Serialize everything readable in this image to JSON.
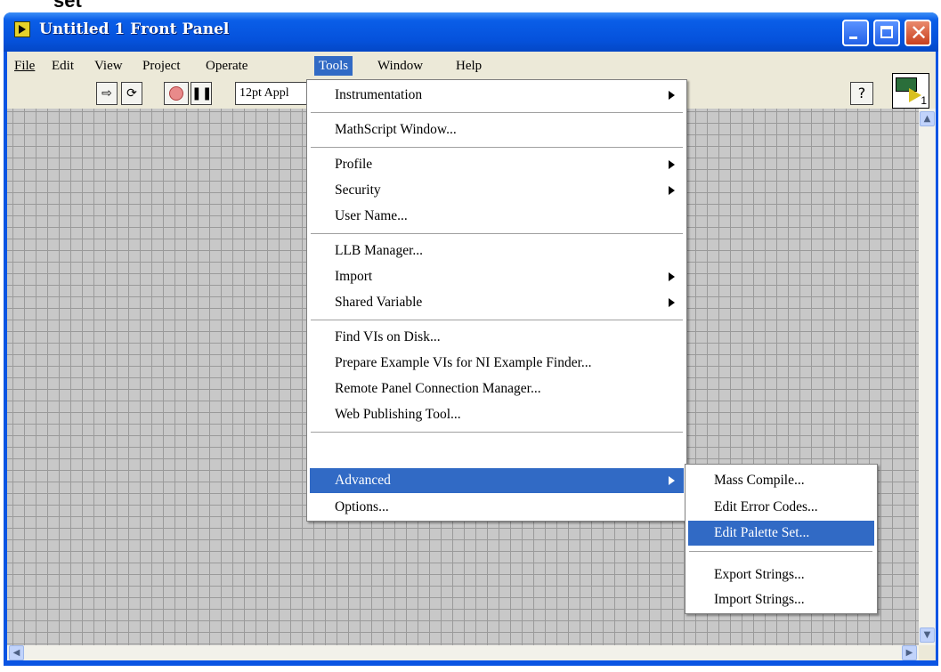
{
  "window": {
    "title": "Untitled 1 Front Panel"
  },
  "menubar": [
    "File",
    "Edit",
    "View",
    "Project",
    "Operate",
    "Tools",
    "Window",
    "Help"
  ],
  "toolbar": {
    "font": "12pt Appl",
    "help": "?"
  },
  "vi_icon": {
    "number": "1"
  },
  "tools_menu": [
    {
      "label": "Instrumentation",
      "submenu": true
    },
    {
      "label": "MathScript Window...",
      "submenu": false
    },
    {
      "label": "Profile",
      "submenu": true
    },
    {
      "label": "Security",
      "submenu": true
    },
    {
      "label": "User Name...",
      "submenu": false
    },
    {
      "label": "LLB Manager...",
      "submenu": false
    },
    {
      "label": "Import",
      "submenu": true
    },
    {
      "label": "Shared Variable",
      "submenu": true
    },
    {
      "label": "Find VIs on Disk...",
      "submenu": false
    },
    {
      "label": "Prepare Example VIs for NI Example Finder...",
      "submenu": false
    },
    {
      "label": "Remote Panel Connection Manager...",
      "submenu": false
    },
    {
      "label": "Web Publishing Tool...",
      "submenu": false
    },
    {
      "label": "Advanced",
      "submenu": true,
      "highlighted": true
    },
    {
      "label": "Options...",
      "submenu": false
    }
  ],
  "advanced_submenu": [
    {
      "label": "Mass Compile..."
    },
    {
      "label": "Edit Error Codes..."
    },
    {
      "label": "Edit Palette Set...",
      "highlighted": true
    },
    {
      "label": "Export Strings..."
    },
    {
      "label": "Import Strings..."
    }
  ],
  "cropped_heading": "set",
  "colors": {
    "titlebar": "#0a54e3",
    "highlight": "#316ac5",
    "grid_bg": "#c8c8c8"
  }
}
